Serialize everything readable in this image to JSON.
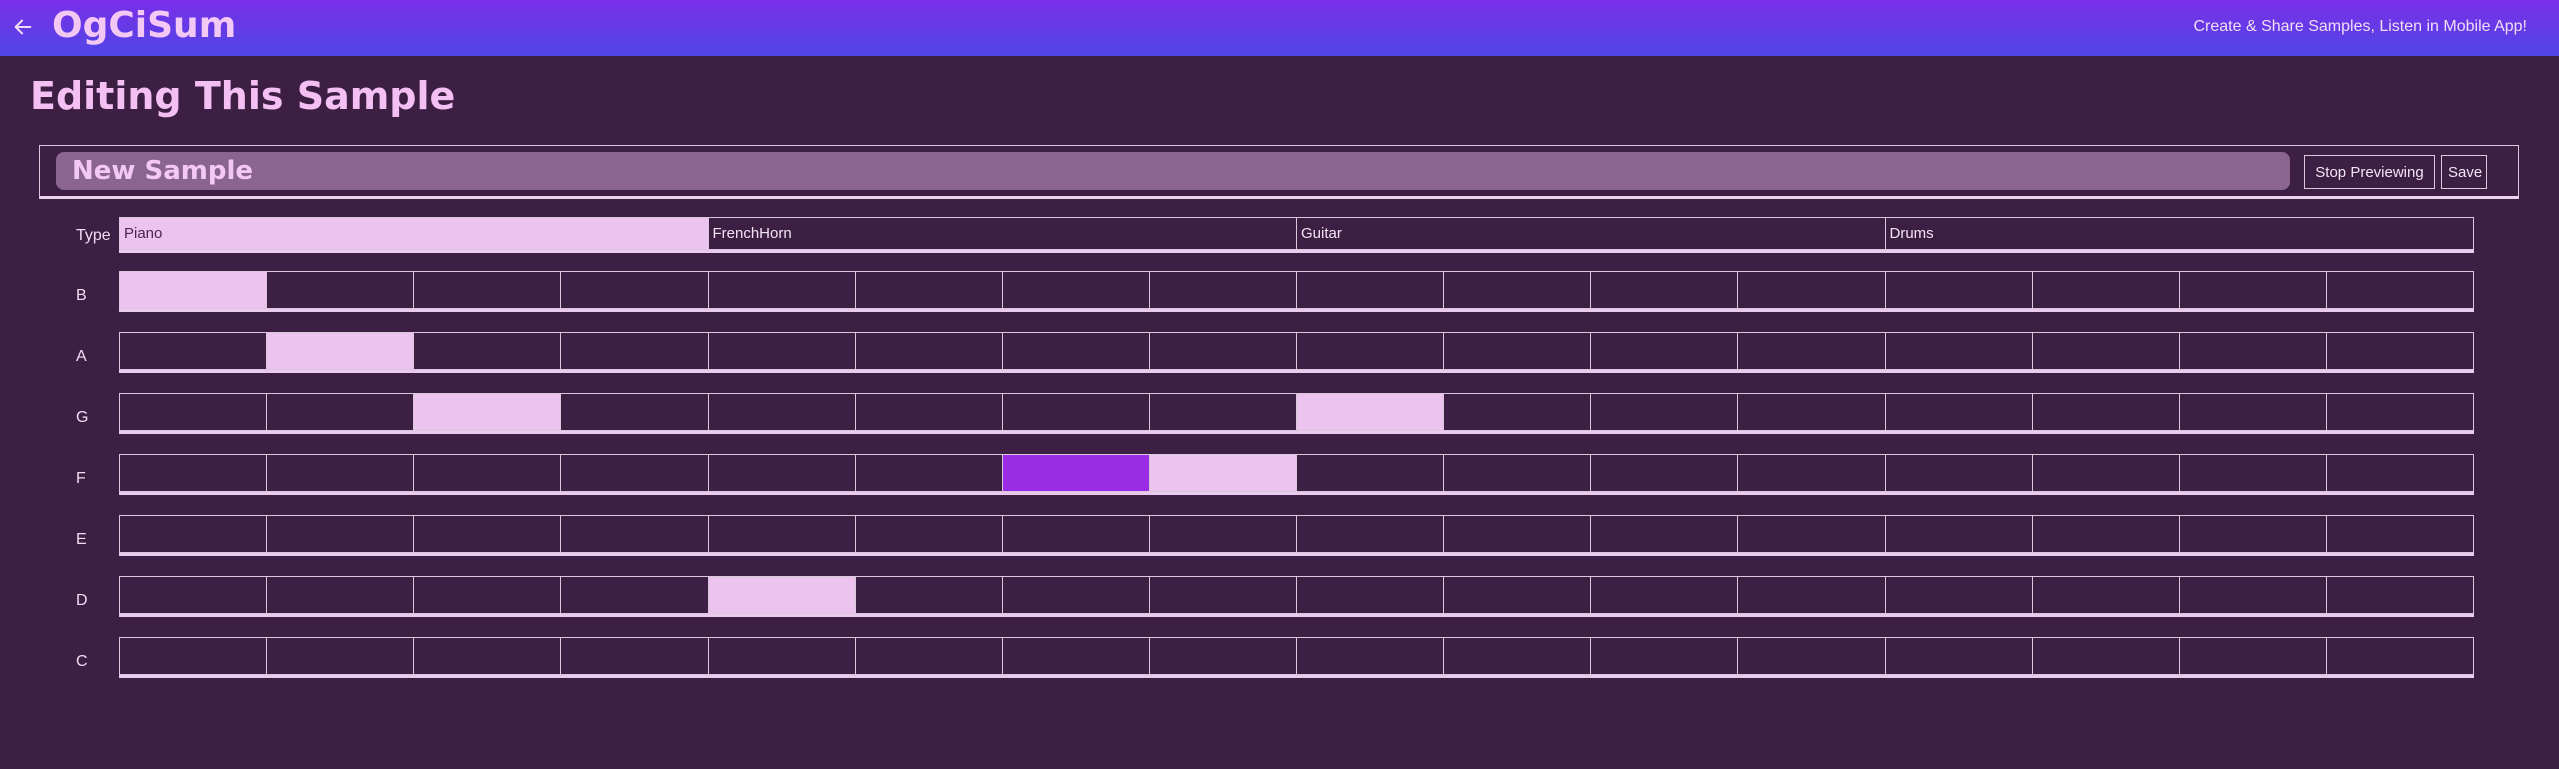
{
  "header": {
    "app_title": "OgCiSum",
    "tagline": "Create & Share Samples, Listen in Mobile App!",
    "back_icon": "arrow-left-icon"
  },
  "page": {
    "title": "Editing This Sample"
  },
  "sample": {
    "name": "New Sample",
    "stop_label": "Stop Previewing",
    "save_label": "Save"
  },
  "type_row": {
    "label": "Type",
    "options": [
      "Piano",
      "FrenchHorn",
      "Guitar",
      "Drums"
    ],
    "selected": "Piano"
  },
  "grid": {
    "steps": 16,
    "playing_step": 6,
    "rows": [
      {
        "note": "B",
        "active": [
          0
        ]
      },
      {
        "note": "A",
        "active": [
          1
        ]
      },
      {
        "note": "G",
        "active": [
          2,
          8
        ]
      },
      {
        "note": "F",
        "active": [
          7
        ]
      },
      {
        "note": "E",
        "active": []
      },
      {
        "note": "D",
        "active": [
          4
        ]
      },
      {
        "note": "C",
        "active": []
      }
    ]
  },
  "colors": {
    "background": "#3d1f44",
    "active_cell": "#ecc2ee",
    "playing_cell": "#9b2de6",
    "header_gradient_start": "#7a2fe8",
    "header_gradient_end": "#4f46e5"
  }
}
